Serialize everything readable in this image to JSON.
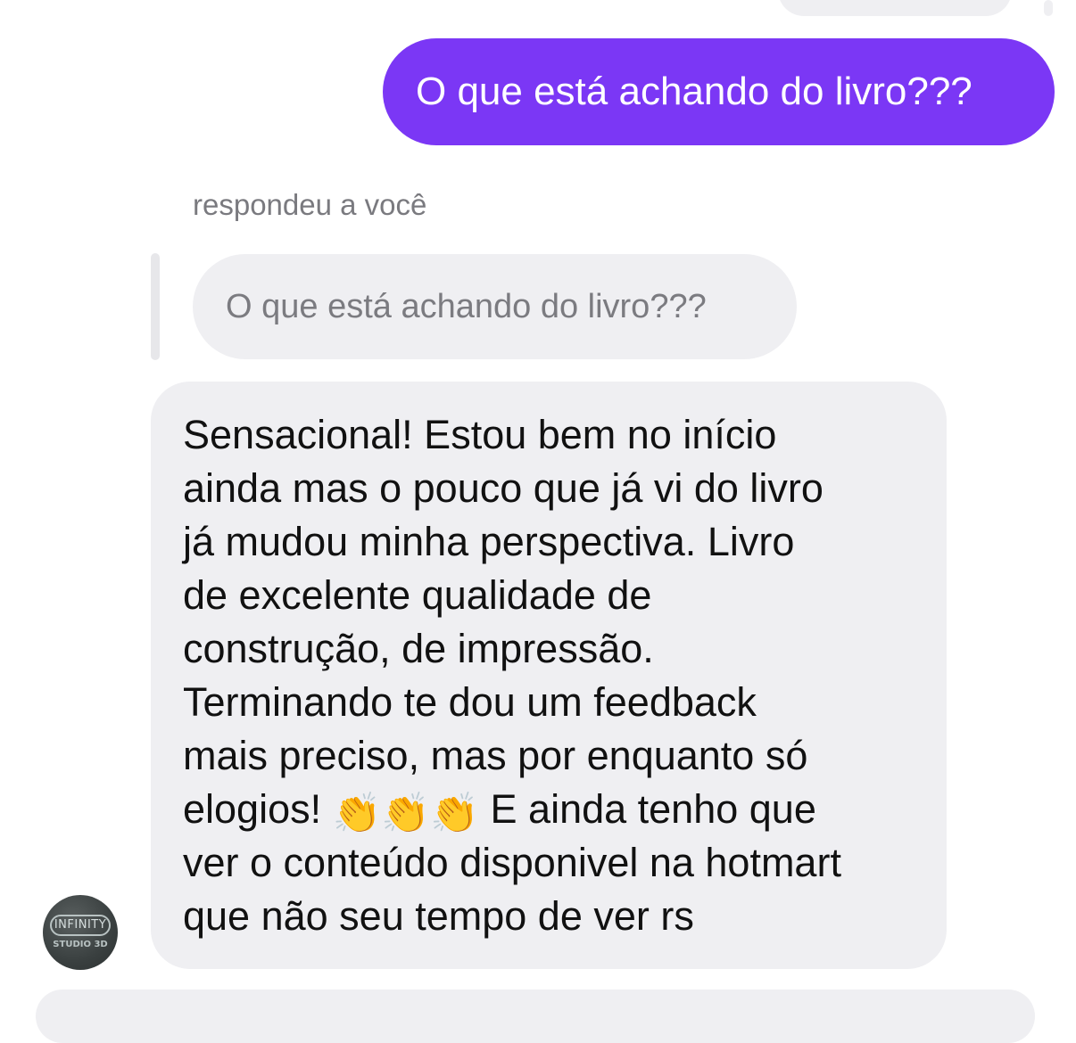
{
  "thread": {
    "sent_message": "O que está achando do livro???",
    "reply_meta": "respondeu a você",
    "quoted_message": "O que está achando do livro???",
    "received_message": {
      "lines": [
        "Sensacional! Estou bem no início",
        "ainda mas o pouco que já vi do livro",
        "já mudou minha perspectiva. Livro",
        "de excelente qualidade de",
        "construção, de impressão.",
        "Terminando te dou um feedback",
        "mais preciso, mas por enquanto só"
      ],
      "emoji_line_start": "elogios!",
      "emoji": "👏",
      "emoji_line_end": "E ainda tenho que",
      "lines_after": [
        "ver o conteúdo disponivel na hotmart",
        "que não seu tempo de ver rs"
      ]
    },
    "avatar": {
      "logo_text": "INFINITY",
      "sub_text": "STUDIO 3D"
    }
  },
  "colors": {
    "sent_bubble": "#7b37f5",
    "received_bubble": "#efeff2"
  }
}
